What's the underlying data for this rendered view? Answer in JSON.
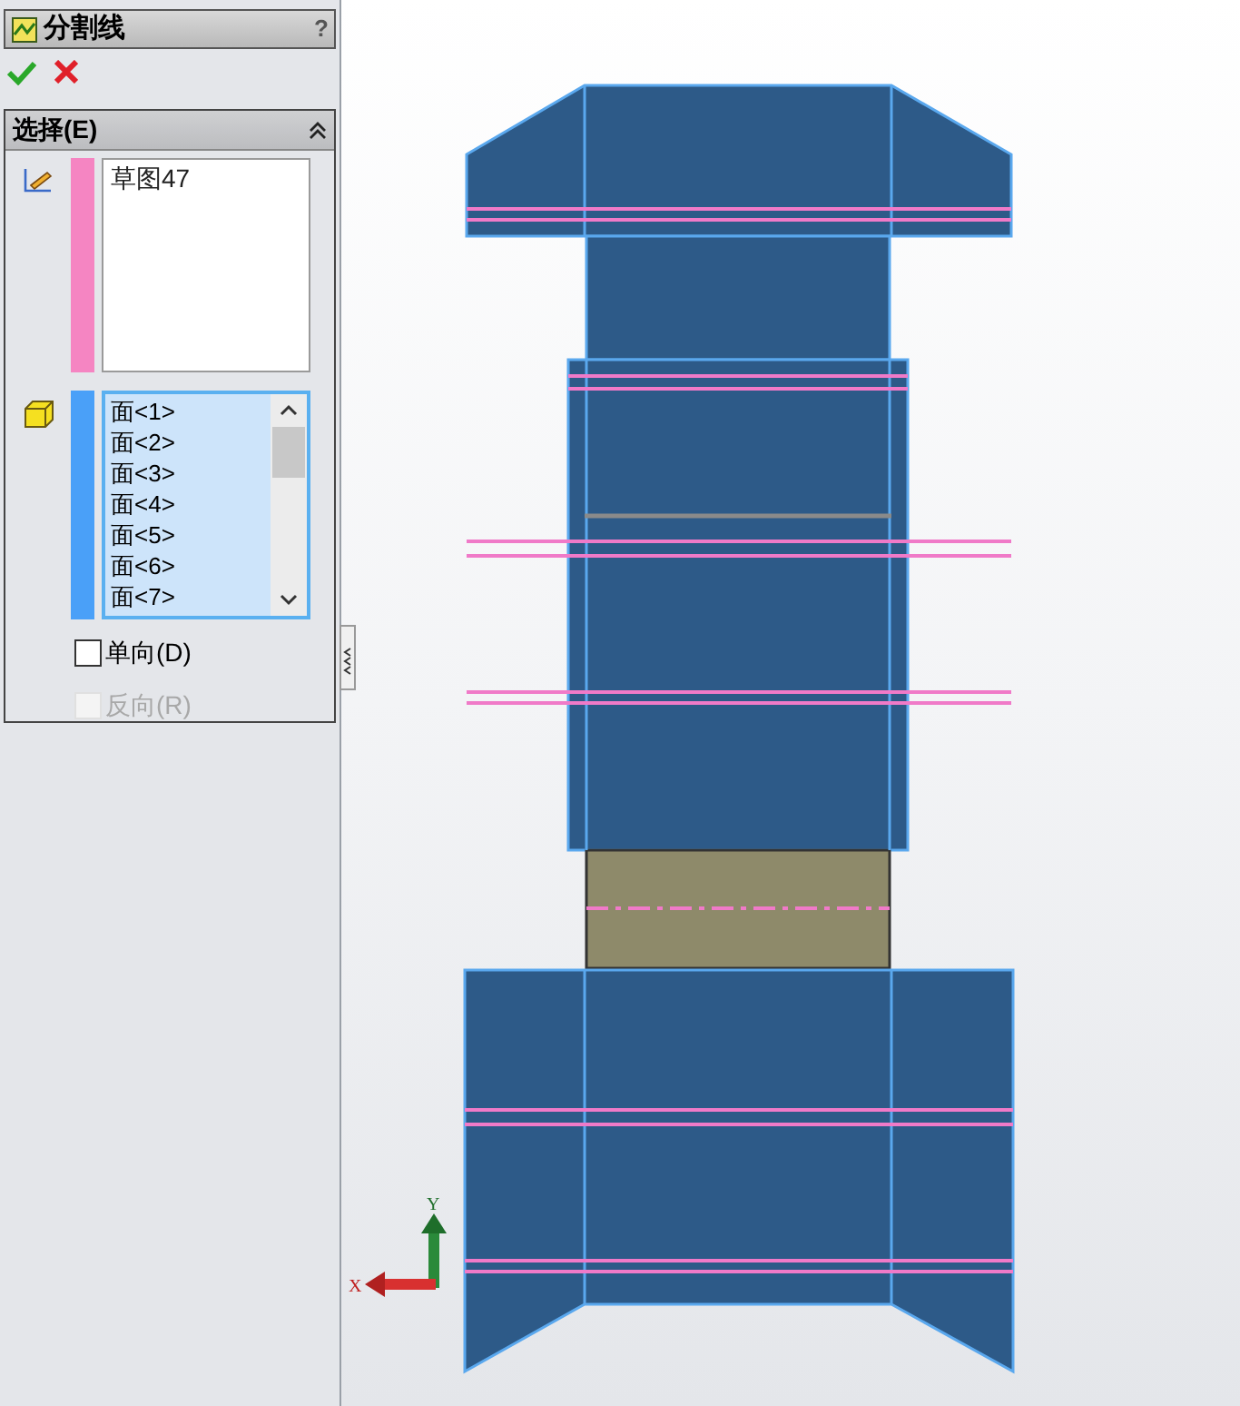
{
  "property_manager": {
    "title": "分割线",
    "help": "?"
  },
  "group": {
    "title": "选择(E)",
    "expanded": true
  },
  "sketch_list": {
    "active": false,
    "items": [
      "草图47"
    ]
  },
  "face_list": {
    "active": true,
    "items": [
      "面<1>",
      "面<2>",
      "面<3>",
      "面<4>",
      "面<5>",
      "面<6>",
      "面<7>"
    ]
  },
  "options": [
    {
      "label": "单向(D)",
      "checked": false,
      "disabled": false
    },
    {
      "label": "反向(R)",
      "checked": false,
      "disabled": true
    }
  ],
  "triad": {
    "x_label": "X",
    "y_label": "Y"
  }
}
